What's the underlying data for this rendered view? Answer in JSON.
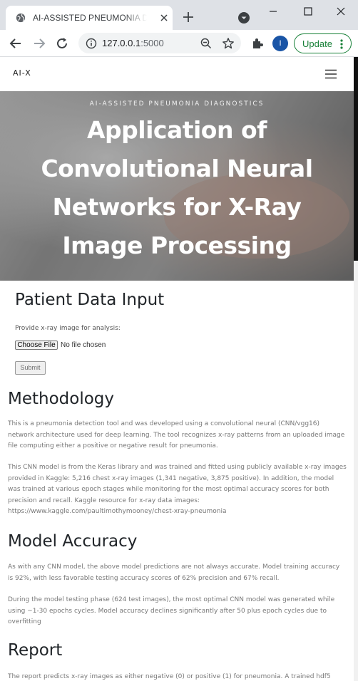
{
  "browser": {
    "tab_title": "AI-ASSISTED PNEUMONIA DIAGNOSTICS",
    "url_host": "127.0.0.1",
    "url_port": ":5000",
    "profile_initial": "I",
    "update_label": "Update"
  },
  "nav": {
    "brand": "AI-X"
  },
  "hero": {
    "kicker": "AI-ASSISTED PNEUMONIA DIAGNOSTICS",
    "title": "Application of Convolutional Neural Networks for X-Ray Image Processing"
  },
  "patient_input": {
    "heading": "Patient Data Input",
    "prompt": "Provide x-ray image for analysis:",
    "choose_file_label": "Choose File",
    "file_status": "No file chosen",
    "submit_label": "Submit"
  },
  "methodology": {
    "heading": "Methodology",
    "p1": "This is a pneumonia detection tool and was developed using a convolutional neural (CNN/vgg16) network architecture used for deep learning. The tool recognizes x-ray patterns from an uploaded image file computing either a positive or negative result for pneumonia.",
    "p2": "This CNN model is from the Keras library and was trained and fitted using publicly available x-ray images provided in Kaggle: 5,216 chest x-ray images (1,341 negative, 3,875 positive). In addition, the model was trained at various epoch stages while monitoring for the most optimal accuracy scores for both precision and recall. Kaggle resource for x-ray data images: https://www.kaggle.com/paultimothymooney/chest-xray-pneumonia"
  },
  "model_accuracy": {
    "heading": "Model Accuracy",
    "p1": "As with any CNN model, the above model predictions are not always accurate. Model training accuracy is 92%, with less favorable testing accuracy scores of 62% precision and 67% recall.",
    "p2": "During the model testing phase (624 test images), the most optimal CNN model was generated while using ~1-30 epochs cycles. Model accuracy declines significantly after 50 plus epoch cycles due to overfitting"
  },
  "report": {
    "heading": "Report",
    "p1": "The report predicts x-ray images as either negative (0) or positive (1) for pneumonia. A trained hdf5"
  }
}
